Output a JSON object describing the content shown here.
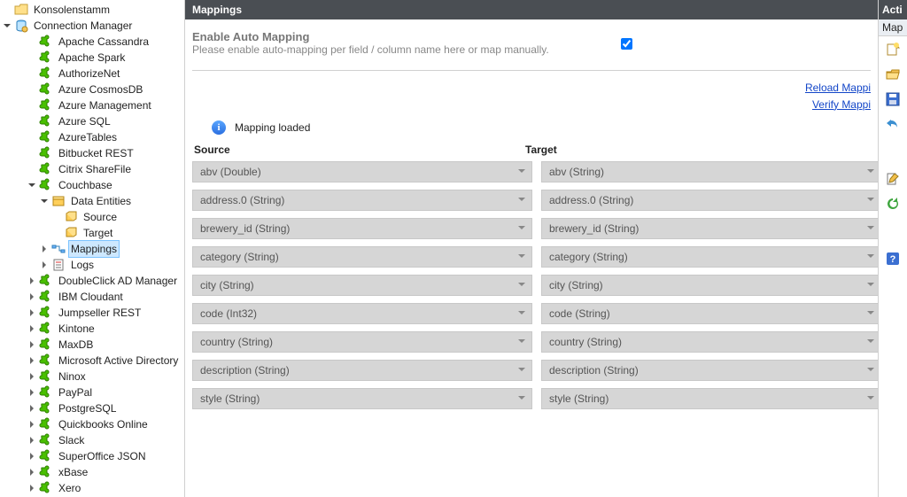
{
  "tree": {
    "root_label": "Konsolenstamm",
    "conn_mgr_label": "Connection Manager",
    "nodes": [
      {
        "label": "Apache Cassandra",
        "icon": "puzzle",
        "exp": "none",
        "depth": 2
      },
      {
        "label": "Apache Spark",
        "icon": "puzzle",
        "exp": "none",
        "depth": 2
      },
      {
        "label": "AuthorizeNet",
        "icon": "puzzle",
        "exp": "none",
        "depth": 2
      },
      {
        "label": "Azure CosmosDB",
        "icon": "puzzle",
        "exp": "none",
        "depth": 2
      },
      {
        "label": "Azure Management",
        "icon": "puzzle",
        "exp": "none",
        "depth": 2
      },
      {
        "label": "Azure SQL",
        "icon": "puzzle",
        "exp": "none",
        "depth": 2
      },
      {
        "label": "AzureTables",
        "icon": "puzzle",
        "exp": "none",
        "depth": 2
      },
      {
        "label": "Bitbucket REST",
        "icon": "puzzle",
        "exp": "none",
        "depth": 2
      },
      {
        "label": "Citrix ShareFile",
        "icon": "puzzle",
        "exp": "none",
        "depth": 2
      },
      {
        "label": "Couchbase",
        "icon": "puzzle",
        "exp": "open",
        "depth": 2
      },
      {
        "label": "Data Entities",
        "icon": "box",
        "exp": "open",
        "depth": 3
      },
      {
        "label": "Source",
        "icon": "cube",
        "exp": "none",
        "depth": 4
      },
      {
        "label": "Target",
        "icon": "cube",
        "exp": "none",
        "depth": 4
      },
      {
        "label": "Mappings",
        "icon": "map",
        "exp": "closed",
        "depth": 3,
        "selected": true
      },
      {
        "label": "Logs",
        "icon": "log",
        "exp": "closed",
        "depth": 3
      },
      {
        "label": "DoubleClick  AD Manager",
        "icon": "puzzle",
        "exp": "closed",
        "depth": 2
      },
      {
        "label": "IBM Cloudant",
        "icon": "puzzle",
        "exp": "closed",
        "depth": 2
      },
      {
        "label": "Jumpseller REST",
        "icon": "puzzle",
        "exp": "closed",
        "depth": 2
      },
      {
        "label": "Kintone",
        "icon": "puzzle",
        "exp": "closed",
        "depth": 2
      },
      {
        "label": "MaxDB",
        "icon": "puzzle",
        "exp": "closed",
        "depth": 2
      },
      {
        "label": "Microsoft Active Directory",
        "icon": "puzzle",
        "exp": "closed",
        "depth": 2
      },
      {
        "label": "Ninox",
        "icon": "puzzle",
        "exp": "closed",
        "depth": 2
      },
      {
        "label": "PayPal",
        "icon": "puzzle",
        "exp": "closed",
        "depth": 2
      },
      {
        "label": "PostgreSQL",
        "icon": "puzzle",
        "exp": "closed",
        "depth": 2
      },
      {
        "label": "Quickbooks Online",
        "icon": "puzzle",
        "exp": "closed",
        "depth": 2
      },
      {
        "label": "Slack",
        "icon": "puzzle",
        "exp": "closed",
        "depth": 2
      },
      {
        "label": "SuperOffice JSON",
        "icon": "puzzle",
        "exp": "closed",
        "depth": 2
      },
      {
        "label": "xBase",
        "icon": "puzzle",
        "exp": "closed",
        "depth": 2
      },
      {
        "label": "Xero",
        "icon": "puzzle",
        "exp": "closed",
        "depth": 2
      }
    ]
  },
  "main": {
    "title": "Mappings",
    "auto_map": {
      "title": "Enable Auto Mapping",
      "subtitle": "Please enable auto-mapping per field / column name here or map manually.",
      "checked": true
    },
    "links": {
      "reload": "Reload Mappi",
      "verify": "Verify Mappi"
    },
    "status": "Mapping loaded",
    "col_source": "Source",
    "col_target": "Target",
    "rows": [
      {
        "src": "abv (Double)",
        "tgt": "abv (String)"
      },
      {
        "src": "address.0 (String)",
        "tgt": "address.0 (String)"
      },
      {
        "src": "brewery_id (String)",
        "tgt": "brewery_id (String)"
      },
      {
        "src": "category (String)",
        "tgt": "category (String)"
      },
      {
        "src": "city (String)",
        "tgt": "city (String)"
      },
      {
        "src": "code (Int32)",
        "tgt": "code (String)"
      },
      {
        "src": "country (String)",
        "tgt": "country (String)"
      },
      {
        "src": "description (String)",
        "tgt": "description (String)"
      },
      {
        "src": "style (String)",
        "tgt": "style (String)"
      }
    ]
  },
  "actions": {
    "title": "Acti",
    "tab": "Map"
  }
}
